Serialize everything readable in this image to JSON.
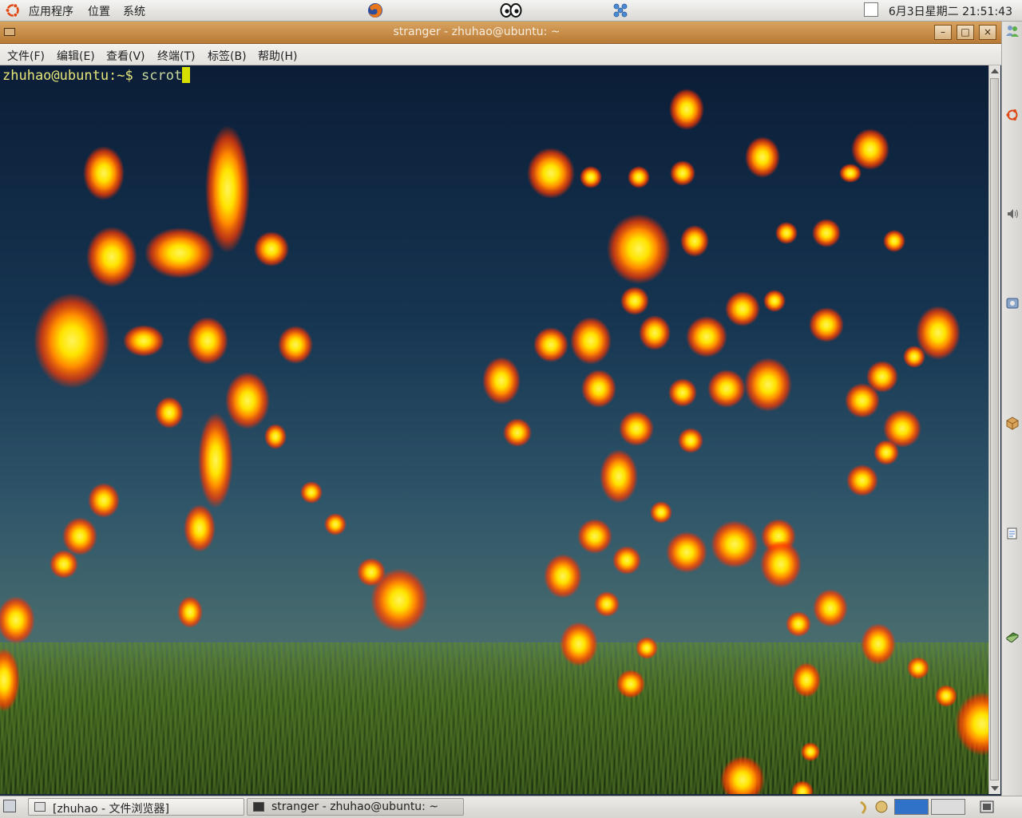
{
  "top_panel": {
    "menus": [
      "应用程序",
      "位置",
      "系统"
    ],
    "clock": "6月3日星期二 21:51:43"
  },
  "window": {
    "title": "stranger - zhuhao@ubuntu: ~",
    "menus": [
      "文件(F)",
      "编辑(E)",
      "查看(V)",
      "终端(T)",
      "标签(B)",
      "帮助(H)"
    ],
    "buttons": {
      "minimize": "–",
      "maximize": "□",
      "close": "×"
    }
  },
  "terminal": {
    "prompt": "zhuhao@ubuntu:~$",
    "command": " scrot"
  },
  "taskbar": {
    "tasks": [
      "[zhuhao - 文件浏览器]",
      "stranger - zhuhao@ubuntu: ~"
    ]
  },
  "colors": {
    "titlebar": "#c48a45",
    "panel": "#e3e2de",
    "terminal_bg": "#0b1d37",
    "glow": "#ff5a00",
    "glow_core": "#ffe600",
    "cursor": "#d8e000"
  }
}
